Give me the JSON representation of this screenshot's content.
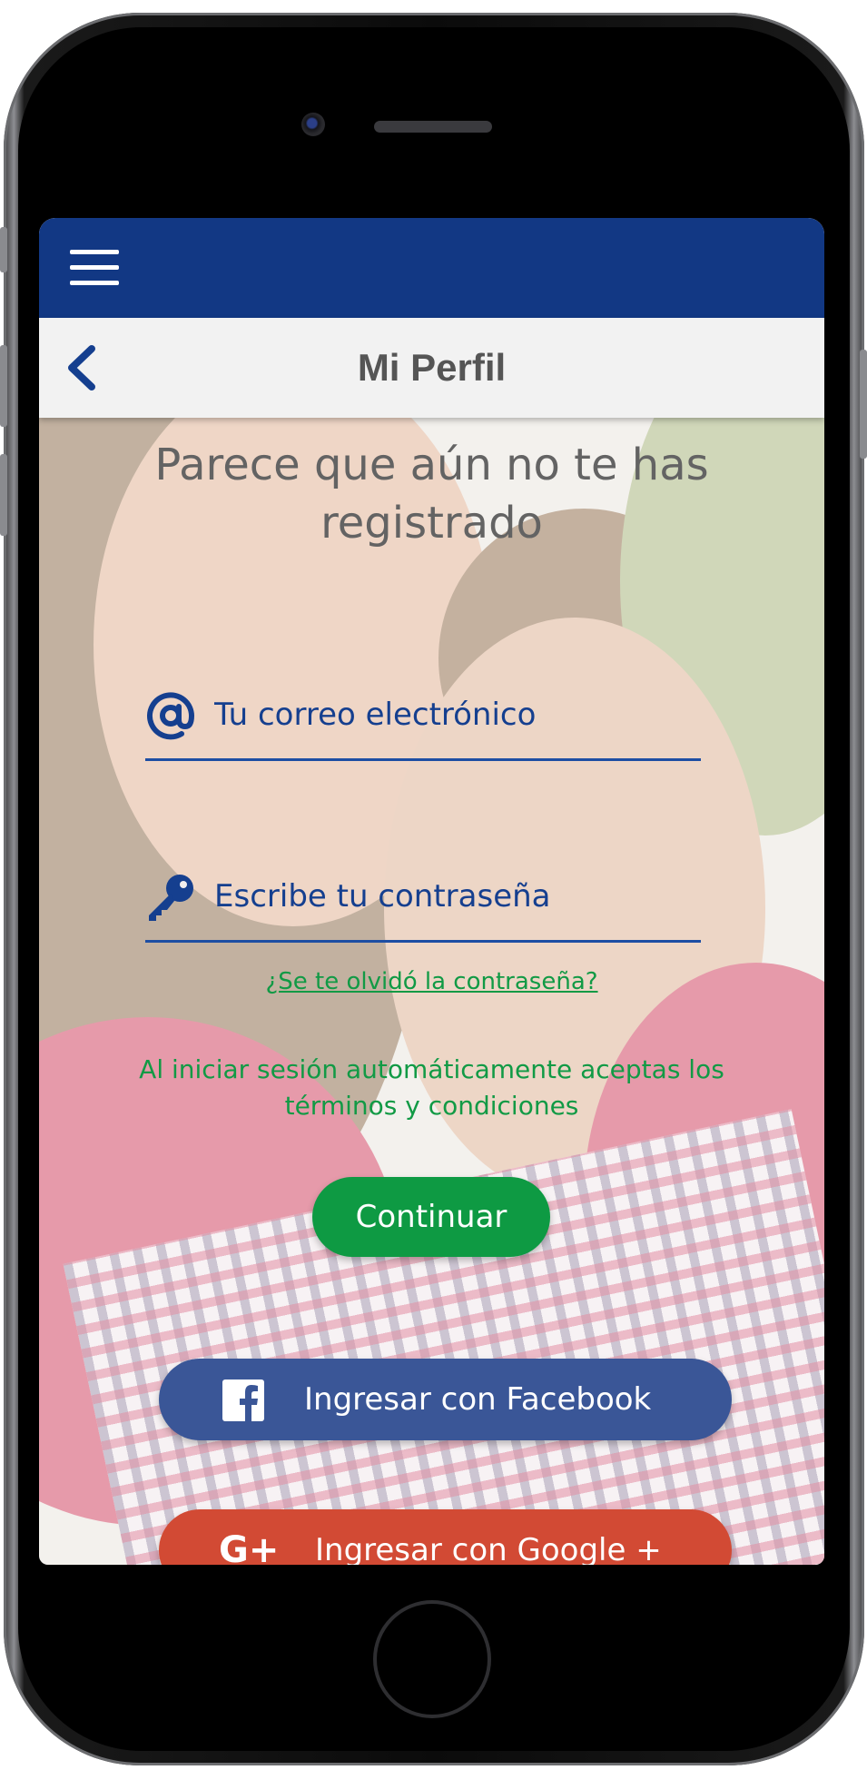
{
  "header": {
    "menu_icon": "hamburger-menu-icon",
    "back_icon": "chevron-left-icon",
    "title": "Mi Perfil"
  },
  "main": {
    "headline": "Parece que aún no te has registrado",
    "email": {
      "icon": "at-icon",
      "placeholder": "Tu correo electrónico",
      "value": ""
    },
    "password": {
      "icon": "key-icon",
      "placeholder": "Escribe tu contraseña",
      "value": ""
    },
    "forgot_link": "¿Se te olvidó la contraseña?",
    "terms_text": "Al iniciar sesión automáticamente aceptas los términos y condiciones",
    "continue_label": "Continuar",
    "facebook": {
      "icon": "facebook-icon",
      "label": "Ingresar con Facebook"
    },
    "google": {
      "icon": "google-plus-icon",
      "icon_text": "G+",
      "label": "Ingresar con Google +"
    }
  },
  "colors": {
    "appbar": "#123884",
    "accent_green": "#0e9a43",
    "facebook_blue": "#3a5697",
    "google_red": "#d24a34",
    "field_text": "#153f8f"
  }
}
